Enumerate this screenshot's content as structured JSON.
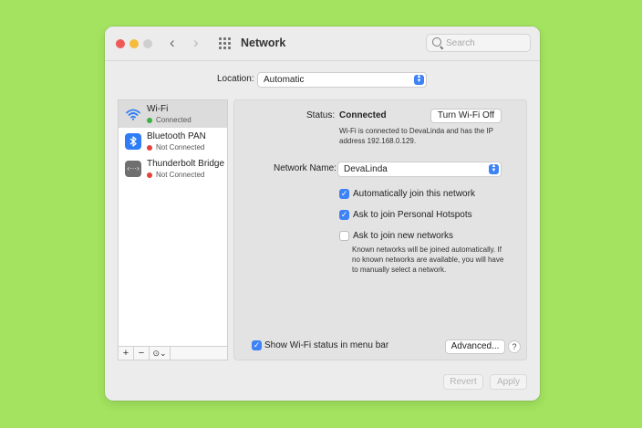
{
  "window": {
    "title": "Network",
    "search_placeholder": "Search",
    "nav_back_glyph": "‹",
    "nav_forward_glyph": "›"
  },
  "location": {
    "label": "Location:",
    "value": "Automatic"
  },
  "services": [
    {
      "name": "Wi-Fi",
      "status": "Connected",
      "status_color": "#3cb043",
      "icon": "wifi-icon",
      "selected": true
    },
    {
      "name": "Bluetooth PAN",
      "status": "Not Connected",
      "status_color": "#e0443a",
      "icon": "bluetooth-icon",
      "selected": false
    },
    {
      "name": "Thunderbolt Bridge",
      "status": "Not Connected",
      "status_color": "#e0443a",
      "icon": "thunderbolt-bridge-icon",
      "selected": false
    }
  ],
  "sidebar_toolbar": {
    "add": "+",
    "remove": "−",
    "action": "⊙⌄"
  },
  "detail": {
    "status_label": "Status:",
    "status_value": "Connected",
    "toggle_button": "Turn Wi-Fi Off",
    "status_desc_line1": "Wi-Fi is connected to DevaLinda and has the IP",
    "status_desc_line2": "address 192.168.0.129.",
    "network_name_label": "Network Name:",
    "network_name_value": "DevaLinda",
    "options": [
      {
        "label": "Automatically join this network",
        "checked": true
      },
      {
        "label": "Ask to join Personal Hotspots",
        "checked": true
      },
      {
        "label": "Ask to join new networks",
        "checked": false
      }
    ],
    "note_line1": "Known networks will be joined automatically. If",
    "note_line2": "no known networks are available, you will have",
    "note_line3": "to manually select a network.",
    "menu_bar_label": "Show Wi-Fi status in menu bar",
    "menu_bar_checked": true,
    "advanced_button": "Advanced...",
    "help_button": "?"
  },
  "footer": {
    "revert": "Revert",
    "apply": "Apply"
  },
  "colors": {
    "background": "#a3e35f",
    "accent": "#3d82f7"
  }
}
